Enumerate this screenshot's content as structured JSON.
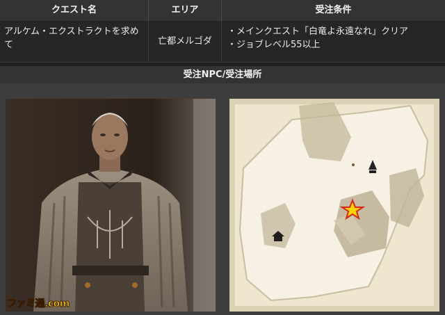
{
  "table": {
    "headers": [
      "クエスト名",
      "エリア",
      "受注条件"
    ],
    "quest_name": "アルケム・エクストラクトを求めて",
    "area": "亡都メルゴダ",
    "conditions": [
      "・メインクエスト「白竜よ永遠なれ」クリア",
      "・ジョブレベル55以上"
    ]
  },
  "section": {
    "title": "受注NPC/受注場所"
  },
  "watermark": "ファミ通.com",
  "colors": {
    "header_bg": "#333335",
    "row_bg": "#262626",
    "map_parchment": "#efe6cf",
    "marker_star": "#ffd400"
  }
}
